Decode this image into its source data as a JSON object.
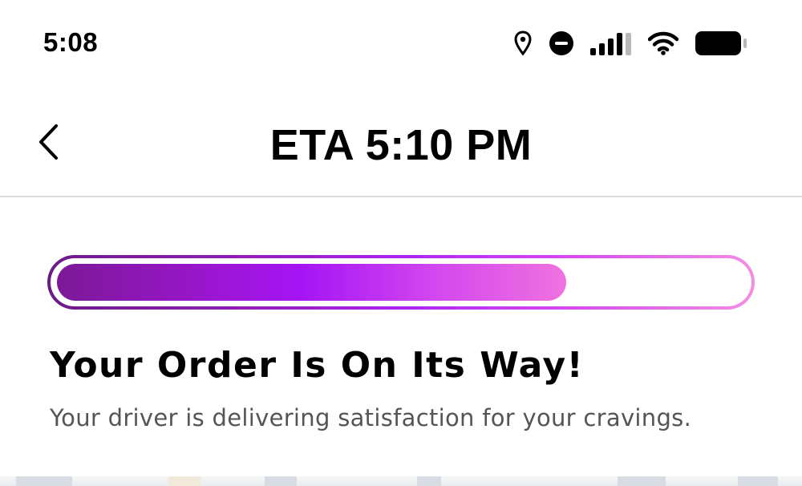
{
  "status_bar": {
    "time": "5:08",
    "icons": [
      "location-icon",
      "do-not-disturb-icon",
      "cellular-signal-icon",
      "wifi-icon",
      "battery-icon"
    ]
  },
  "header": {
    "back_icon": "chevron-left-icon",
    "title": "ETA 5:10 PM"
  },
  "progress": {
    "fraction": 0.74,
    "gradient": [
      "#7c1896",
      "#a514f5",
      "#f072df"
    ],
    "border_gradient": [
      "#6a1b86",
      "#b020f0",
      "#f28ee0"
    ]
  },
  "order": {
    "heading": "Your Order Is On Its Way!",
    "subtext": "Your driver is delivering satisfaction for your cravings."
  },
  "colors": {
    "background": "#ffffff",
    "text_primary": "#000000",
    "text_secondary": "#555555",
    "divider": "#dedede"
  }
}
